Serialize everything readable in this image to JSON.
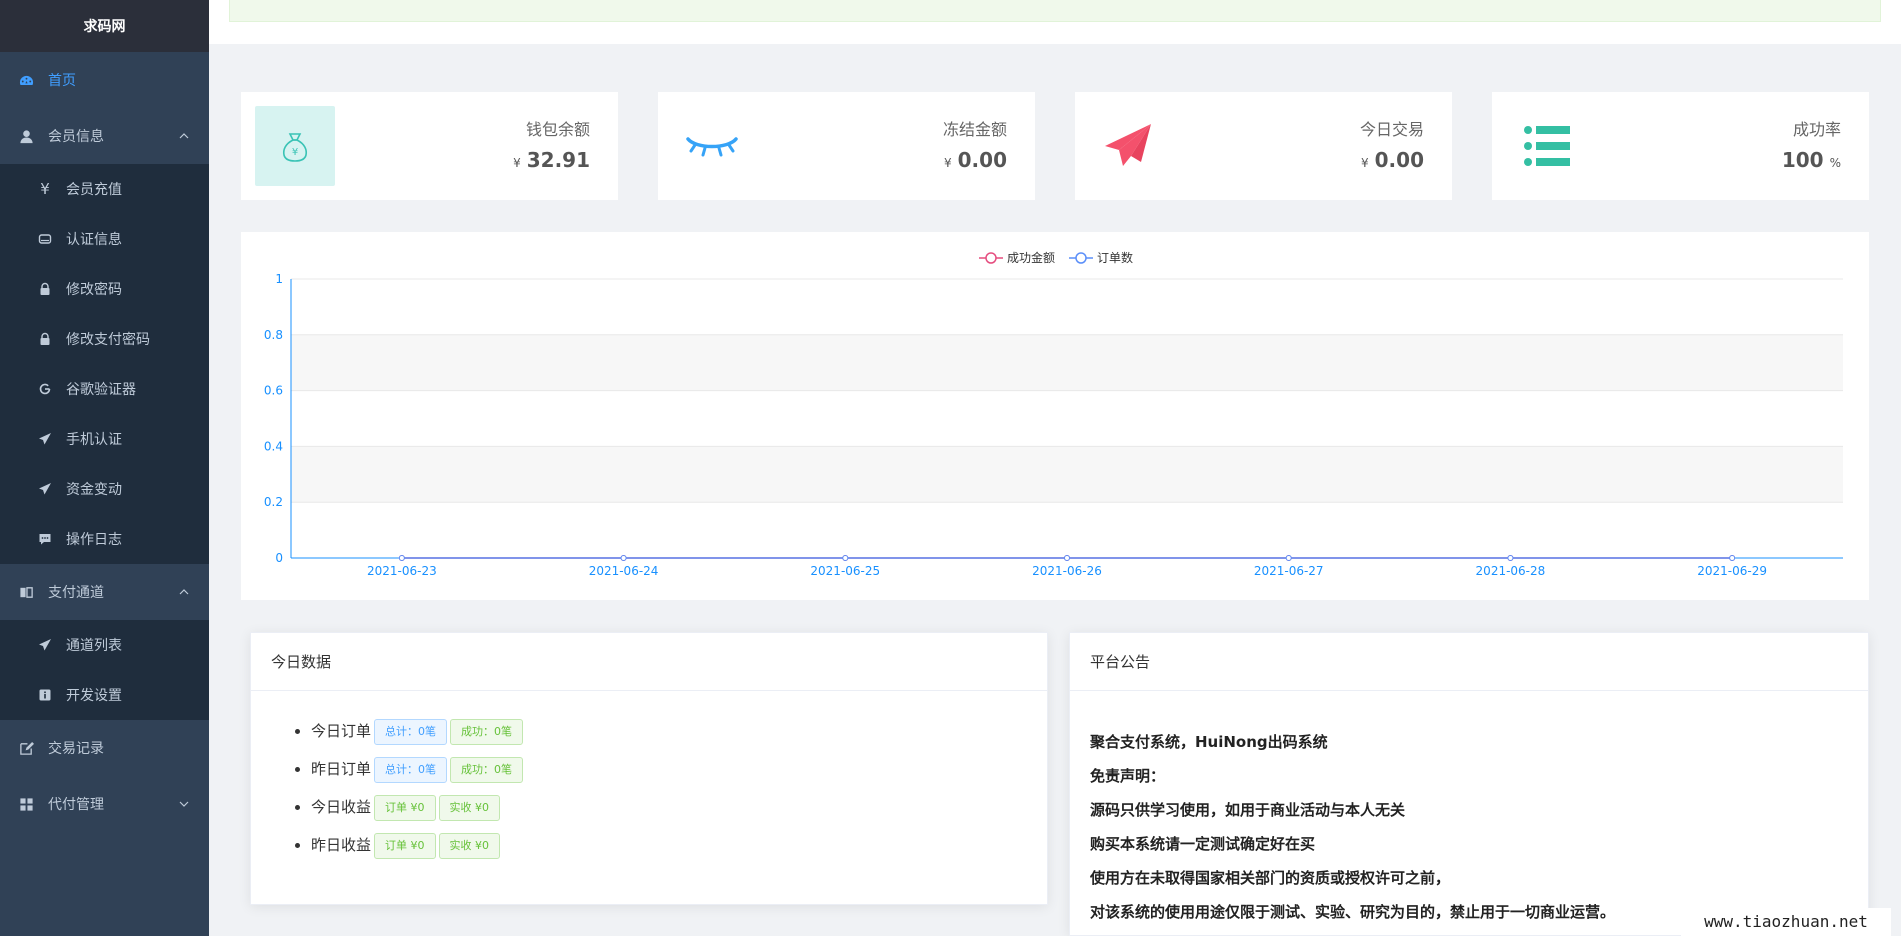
{
  "brand": "求码网",
  "sidebar": {
    "home": "首页",
    "member_info": "会员信息",
    "member_sub": [
      "会员充值",
      "认证信息",
      "修改密码",
      "修改支付密码",
      "谷歌验证器",
      "手机认证",
      "资金变动",
      "操作日志"
    ],
    "pay_channel": "支付通道",
    "pay_sub": [
      "通道列表",
      "开发设置"
    ],
    "trade_record": "交易记录",
    "payout_manage": "代付管理"
  },
  "cards": [
    {
      "label": "钱包余额",
      "currency": "¥",
      "value": "32.91"
    },
    {
      "label": "冻结金额",
      "currency": "¥",
      "value": "0.00"
    },
    {
      "label": "今日交易",
      "currency": "¥",
      "value": "0.00"
    },
    {
      "label": "成功率",
      "value": "100",
      "unit": "%"
    }
  ],
  "chart_data": {
    "type": "line",
    "x": [
      "2021-06-23",
      "2021-06-24",
      "2021-06-25",
      "2021-06-26",
      "2021-06-27",
      "2021-06-28",
      "2021-06-29"
    ],
    "series": [
      {
        "name": "成功金额",
        "values": [
          0,
          0,
          0,
          0,
          0,
          0,
          0
        ],
        "color": "#e54d7f"
      },
      {
        "name": "订单数",
        "values": [
          0,
          0,
          0,
          0,
          0,
          0,
          0
        ],
        "color": "#5b8ff9"
      }
    ],
    "yticks": [
      "0",
      "0.2",
      "0.4",
      "0.6",
      "0.8",
      "1"
    ],
    "ylim": [
      0,
      1
    ],
    "legend": "top-center",
    "axis_color": "#1890ff"
  },
  "today": {
    "title": "今日数据",
    "rows": [
      {
        "label": "今日订单",
        "tag1": "总计：0笔",
        "tag2": "成功：0笔"
      },
      {
        "label": "昨日订单",
        "tag1": "总计：0笔",
        "tag2": "成功：0笔"
      },
      {
        "label": "今日收益",
        "tag1": "订单 ¥0",
        "tag2": "实收 ¥0"
      },
      {
        "label": "昨日收益",
        "tag1": "订单 ¥0",
        "tag2": "实收 ¥0"
      }
    ]
  },
  "notice": {
    "title": "平台公告",
    "lines": [
      "聚合支付系统，HuiNong出码系统",
      "免责声明：",
      "源码只供学习使用，如用于商业活动与本人无关",
      "购买本系统请一定测试确定好在买",
      "使用方在未取得国家相关部门的资质或授权许可之前，",
      "对该系统的使用用途仅限于测试、实验、研究为目的，禁止用于一切商业运营。"
    ]
  },
  "watermark": "www.tiaozhuan.net"
}
